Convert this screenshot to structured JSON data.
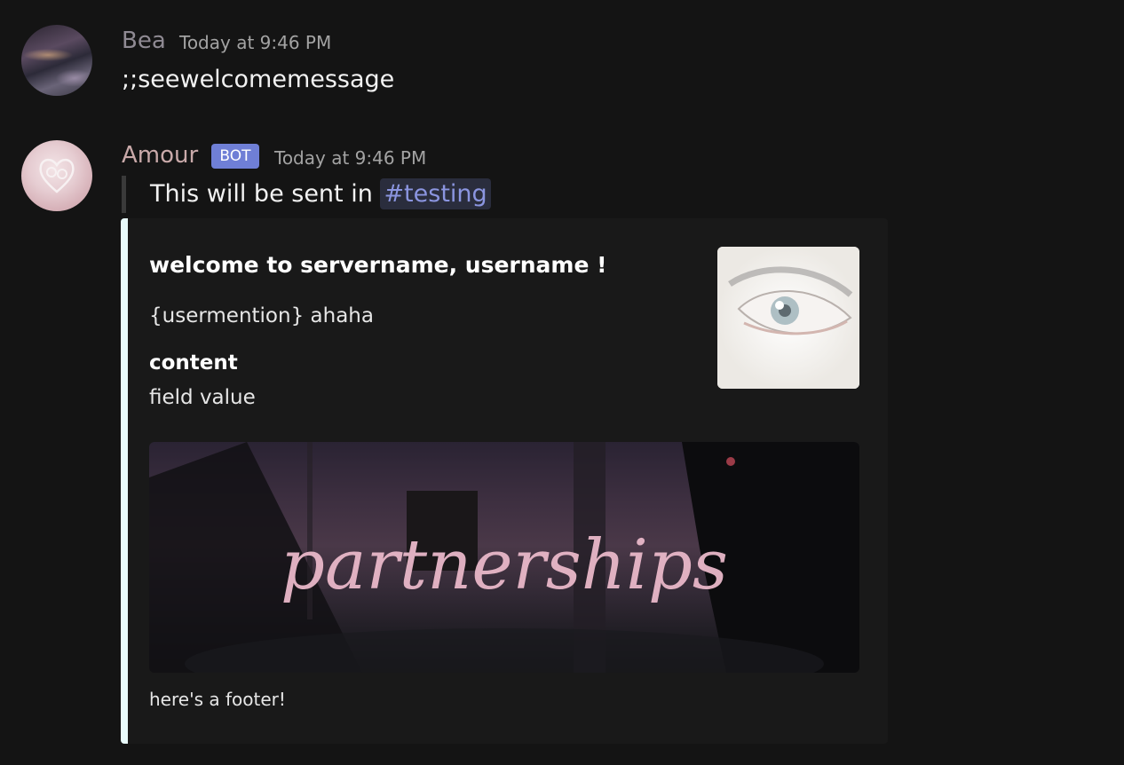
{
  "messages": [
    {
      "author": "Bea",
      "timestamp": "Today at 9:46 PM",
      "text": ";;seewelcomemessage"
    },
    {
      "author": "Amour",
      "badge": "BOT",
      "timestamp": "Today at 9:46 PM",
      "reply_prefix": "This will be sent in",
      "channel_mention": "#testing",
      "embed": {
        "accent_color": "#e9fbfb",
        "title": "welcome to servername, username !",
        "description": "{usermention} ahaha",
        "field_name": "content",
        "field_value": "field value",
        "image_text": "partnerships",
        "footer": "here's a footer!"
      }
    }
  ],
  "colors": {
    "background": "#141414",
    "bot_badge": "#6f7fd6",
    "mention": "#8b95e0"
  }
}
